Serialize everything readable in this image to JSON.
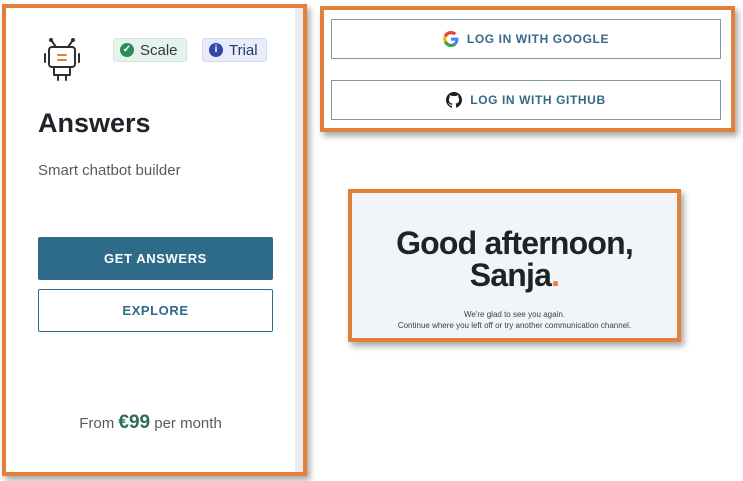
{
  "card": {
    "badges": {
      "scale": {
        "label": "Scale",
        "icon": "check-circle-icon"
      },
      "trial": {
        "label": "Trial",
        "icon": "info-circle-icon"
      }
    },
    "title": "Answers",
    "subtitle": "Smart chatbot builder",
    "primary_button": "GET ANSWERS",
    "secondary_button": "EXPLORE",
    "price": {
      "prefix": "From",
      "amount": "€99",
      "suffix": "per month"
    },
    "icon": "robot-icon",
    "colors": {
      "primary": "#2e6b89",
      "price": "#2c6e57"
    }
  },
  "login": {
    "google_label": "LOG IN WITH GOOGLE",
    "github_label": "LOG IN WITH GITHUB"
  },
  "greeting": {
    "line1": "Good afternoon,",
    "name": "Sanja",
    "punct": ".",
    "sub1": "We're glad to see you again.",
    "sub2": "Continue where you left off or try another communication channel.",
    "accent": "#e27f3a"
  }
}
